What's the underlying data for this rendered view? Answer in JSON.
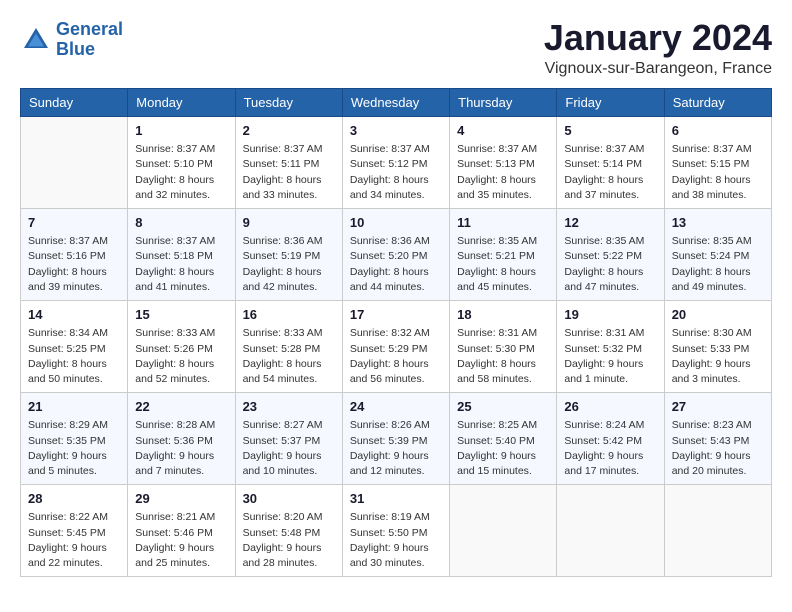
{
  "logo": {
    "line1": "General",
    "line2": "Blue"
  },
  "title": "January 2024",
  "subtitle": "Vignoux-sur-Barangeon, France",
  "days_header": [
    "Sunday",
    "Monday",
    "Tuesday",
    "Wednesday",
    "Thursday",
    "Friday",
    "Saturday"
  ],
  "weeks": [
    [
      {
        "day": "",
        "info": ""
      },
      {
        "day": "1",
        "info": "Sunrise: 8:37 AM\nSunset: 5:10 PM\nDaylight: 8 hours\nand 32 minutes."
      },
      {
        "day": "2",
        "info": "Sunrise: 8:37 AM\nSunset: 5:11 PM\nDaylight: 8 hours\nand 33 minutes."
      },
      {
        "day": "3",
        "info": "Sunrise: 8:37 AM\nSunset: 5:12 PM\nDaylight: 8 hours\nand 34 minutes."
      },
      {
        "day": "4",
        "info": "Sunrise: 8:37 AM\nSunset: 5:13 PM\nDaylight: 8 hours\nand 35 minutes."
      },
      {
        "day": "5",
        "info": "Sunrise: 8:37 AM\nSunset: 5:14 PM\nDaylight: 8 hours\nand 37 minutes."
      },
      {
        "day": "6",
        "info": "Sunrise: 8:37 AM\nSunset: 5:15 PM\nDaylight: 8 hours\nand 38 minutes."
      }
    ],
    [
      {
        "day": "7",
        "info": "Sunrise: 8:37 AM\nSunset: 5:16 PM\nDaylight: 8 hours\nand 39 minutes."
      },
      {
        "day": "8",
        "info": "Sunrise: 8:37 AM\nSunset: 5:18 PM\nDaylight: 8 hours\nand 41 minutes."
      },
      {
        "day": "9",
        "info": "Sunrise: 8:36 AM\nSunset: 5:19 PM\nDaylight: 8 hours\nand 42 minutes."
      },
      {
        "day": "10",
        "info": "Sunrise: 8:36 AM\nSunset: 5:20 PM\nDaylight: 8 hours\nand 44 minutes."
      },
      {
        "day": "11",
        "info": "Sunrise: 8:35 AM\nSunset: 5:21 PM\nDaylight: 8 hours\nand 45 minutes."
      },
      {
        "day": "12",
        "info": "Sunrise: 8:35 AM\nSunset: 5:22 PM\nDaylight: 8 hours\nand 47 minutes."
      },
      {
        "day": "13",
        "info": "Sunrise: 8:35 AM\nSunset: 5:24 PM\nDaylight: 8 hours\nand 49 minutes."
      }
    ],
    [
      {
        "day": "14",
        "info": "Sunrise: 8:34 AM\nSunset: 5:25 PM\nDaylight: 8 hours\nand 50 minutes."
      },
      {
        "day": "15",
        "info": "Sunrise: 8:33 AM\nSunset: 5:26 PM\nDaylight: 8 hours\nand 52 minutes."
      },
      {
        "day": "16",
        "info": "Sunrise: 8:33 AM\nSunset: 5:28 PM\nDaylight: 8 hours\nand 54 minutes."
      },
      {
        "day": "17",
        "info": "Sunrise: 8:32 AM\nSunset: 5:29 PM\nDaylight: 8 hours\nand 56 minutes."
      },
      {
        "day": "18",
        "info": "Sunrise: 8:31 AM\nSunset: 5:30 PM\nDaylight: 8 hours\nand 58 minutes."
      },
      {
        "day": "19",
        "info": "Sunrise: 8:31 AM\nSunset: 5:32 PM\nDaylight: 9 hours\nand 1 minute."
      },
      {
        "day": "20",
        "info": "Sunrise: 8:30 AM\nSunset: 5:33 PM\nDaylight: 9 hours\nand 3 minutes."
      }
    ],
    [
      {
        "day": "21",
        "info": "Sunrise: 8:29 AM\nSunset: 5:35 PM\nDaylight: 9 hours\nand 5 minutes."
      },
      {
        "day": "22",
        "info": "Sunrise: 8:28 AM\nSunset: 5:36 PM\nDaylight: 9 hours\nand 7 minutes."
      },
      {
        "day": "23",
        "info": "Sunrise: 8:27 AM\nSunset: 5:37 PM\nDaylight: 9 hours\nand 10 minutes."
      },
      {
        "day": "24",
        "info": "Sunrise: 8:26 AM\nSunset: 5:39 PM\nDaylight: 9 hours\nand 12 minutes."
      },
      {
        "day": "25",
        "info": "Sunrise: 8:25 AM\nSunset: 5:40 PM\nDaylight: 9 hours\nand 15 minutes."
      },
      {
        "day": "26",
        "info": "Sunrise: 8:24 AM\nSunset: 5:42 PM\nDaylight: 9 hours\nand 17 minutes."
      },
      {
        "day": "27",
        "info": "Sunrise: 8:23 AM\nSunset: 5:43 PM\nDaylight: 9 hours\nand 20 minutes."
      }
    ],
    [
      {
        "day": "28",
        "info": "Sunrise: 8:22 AM\nSunset: 5:45 PM\nDaylight: 9 hours\nand 22 minutes."
      },
      {
        "day": "29",
        "info": "Sunrise: 8:21 AM\nSunset: 5:46 PM\nDaylight: 9 hours\nand 25 minutes."
      },
      {
        "day": "30",
        "info": "Sunrise: 8:20 AM\nSunset: 5:48 PM\nDaylight: 9 hours\nand 28 minutes."
      },
      {
        "day": "31",
        "info": "Sunrise: 8:19 AM\nSunset: 5:50 PM\nDaylight: 9 hours\nand 30 minutes."
      },
      {
        "day": "",
        "info": ""
      },
      {
        "day": "",
        "info": ""
      },
      {
        "day": "",
        "info": ""
      }
    ]
  ]
}
